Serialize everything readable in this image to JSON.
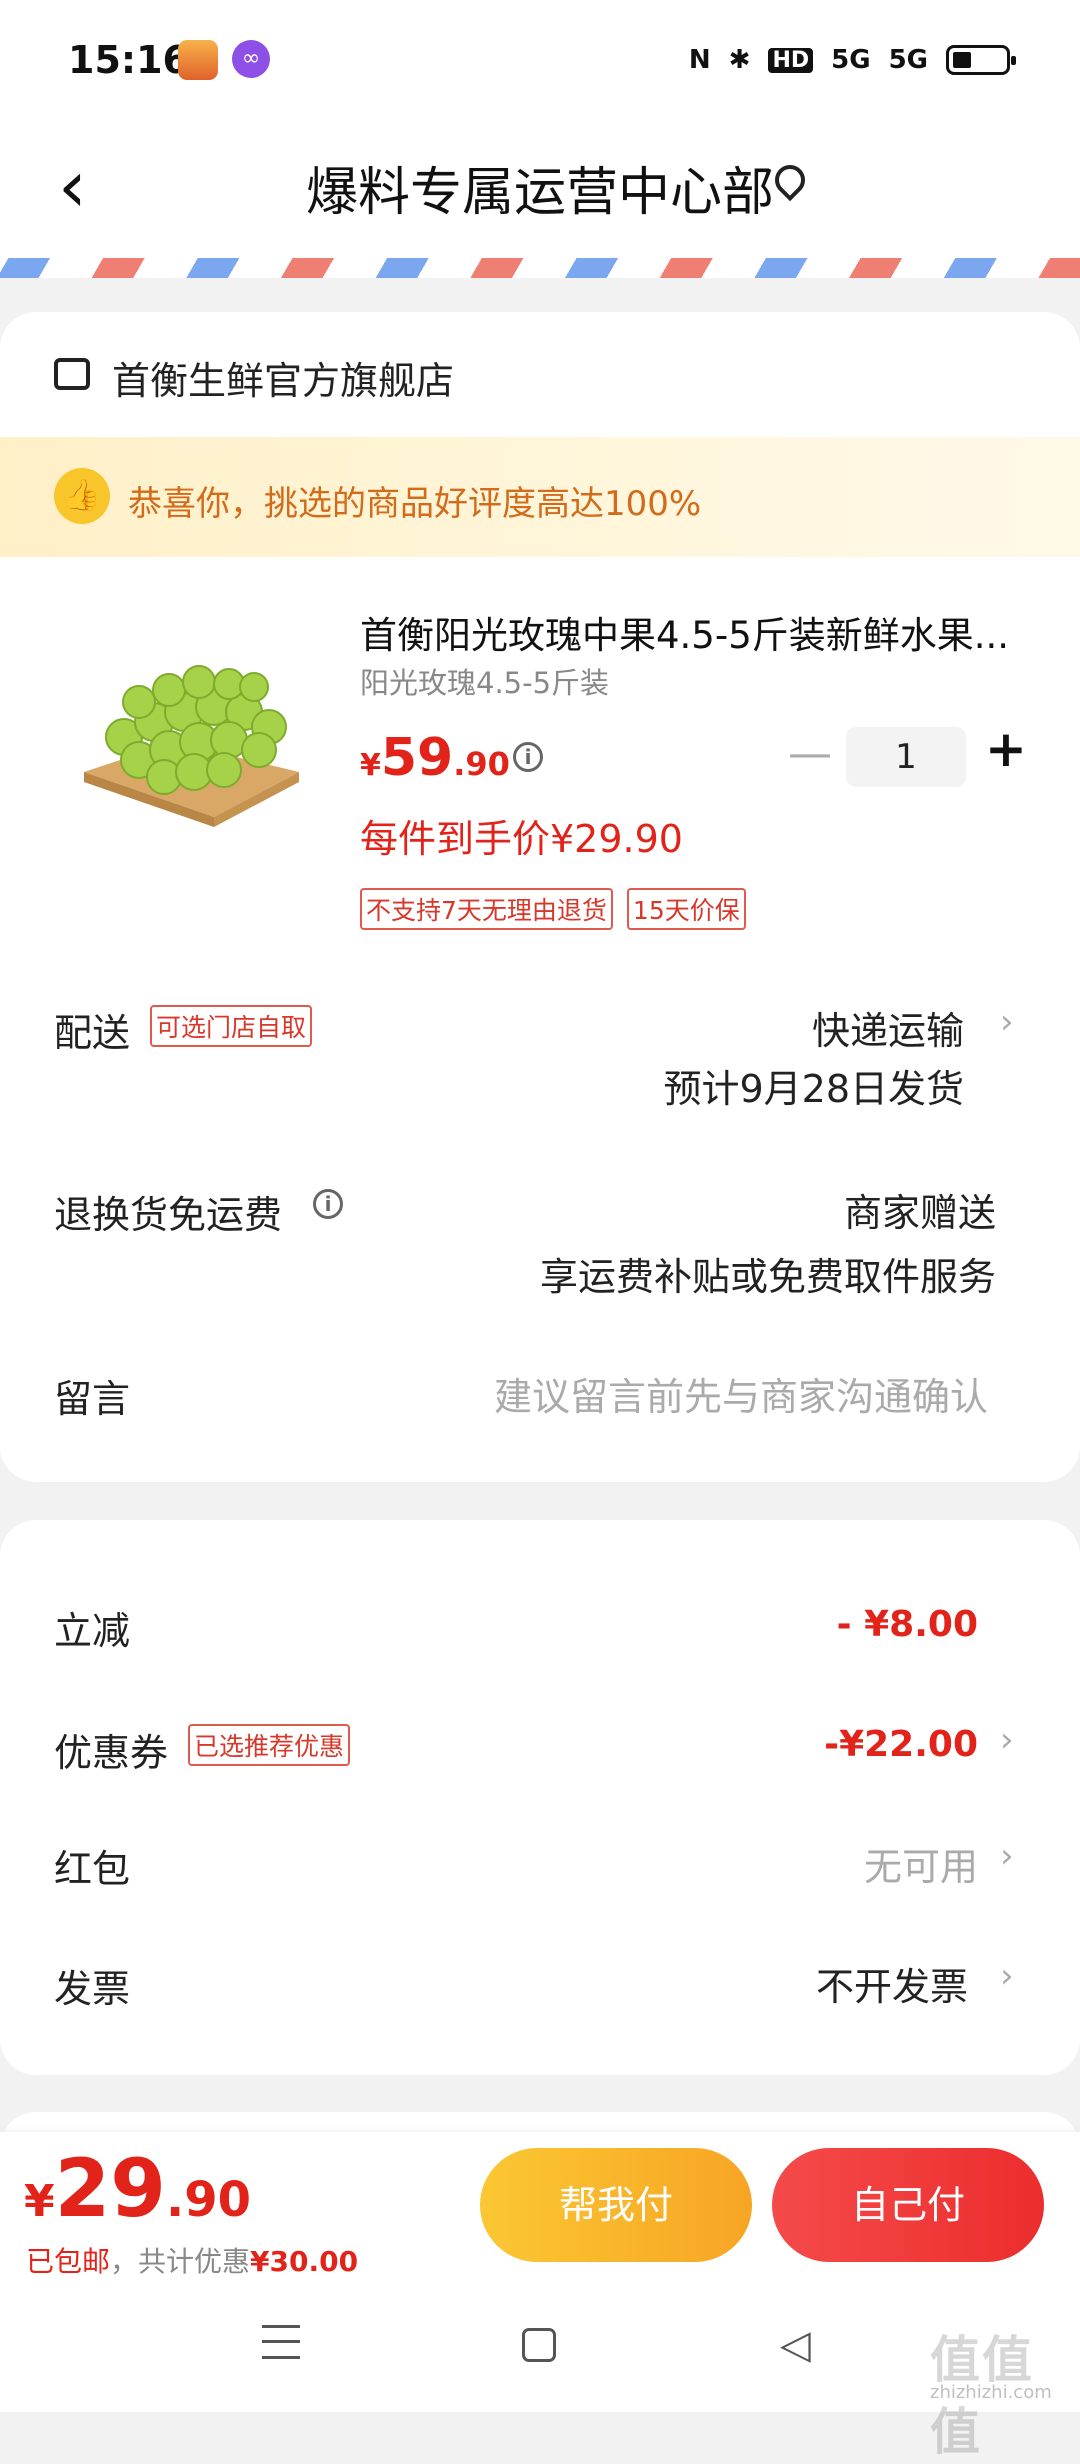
{
  "status_bar": {
    "time": "15:16",
    "network_labels": [
      "N",
      "HD",
      "5G",
      "5G"
    ]
  },
  "header": {
    "title": "爆料专属运营中心部"
  },
  "store": {
    "name": "首衡生鲜官方旗舰店"
  },
  "praise_banner": {
    "text": "恭喜你，挑选的商品好评度高达100%"
  },
  "product": {
    "title": "首衡阳光玫瑰中果4.5-5斤装新鲜水果...",
    "spec": "阳光玫瑰4.5-5斤装",
    "price_currency": "¥",
    "price_int": "59",
    "price_dec": ".90",
    "quantity": "1",
    "final_price_text": "每件到手价¥29.90",
    "tags": [
      "不支持7天无理由退货",
      "15天价保"
    ]
  },
  "delivery": {
    "label": "配送",
    "tag": "可选门店自取",
    "method": "快递运输",
    "estimate": "预计9月28日发货"
  },
  "return_shipping": {
    "label": "退换货免运费",
    "value": "商家赠送",
    "desc": "享运费补贴或免费取件服务"
  },
  "message": {
    "label": "留言",
    "placeholder": "建议留言前先与商家沟通确认"
  },
  "discounts": {
    "instant": {
      "label": "立减",
      "value": "- ¥8.00"
    },
    "coupon": {
      "label": "优惠券",
      "tag": "已选推荐优惠",
      "value": "-¥22.00"
    },
    "red_packet": {
      "label": "红包",
      "value": "无可用"
    },
    "invoice": {
      "label": "发票",
      "value": "不开发票"
    }
  },
  "footer": {
    "total_currency": "¥",
    "total_int": "29",
    "total_dec": ".90",
    "shipping_text": "已包邮",
    "savings_label": "，共计优惠",
    "savings_value": "¥30.00",
    "help_pay_label": "帮我付",
    "self_pay_label": "自己付"
  },
  "watermark": {
    "text": "值值值",
    "sub": "zhizhizhi.com"
  },
  "colors": {
    "accent_red": "#e2231a",
    "help_button": "#fbc733",
    "self_button": "#f54a4a"
  }
}
